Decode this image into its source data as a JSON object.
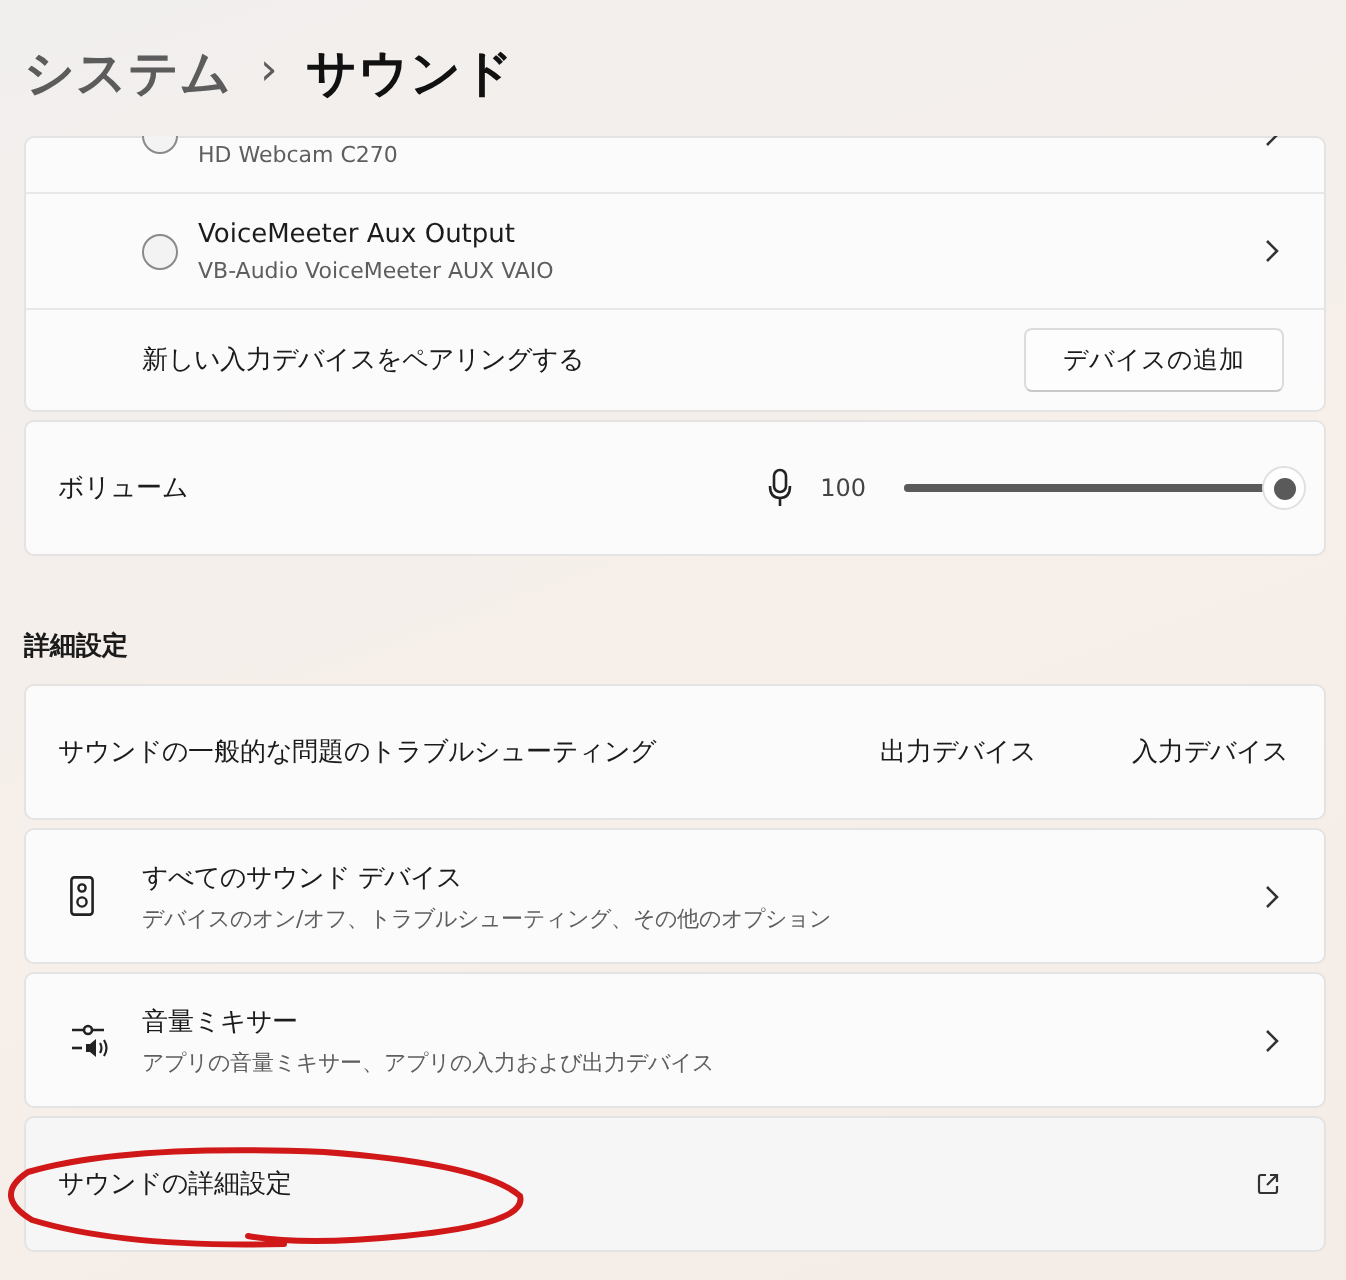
{
  "breadcrumb": {
    "parent": "システム",
    "separator": "›",
    "current": "サウンド"
  },
  "devices": [
    {
      "subtitle": "HD Webcam C270",
      "selected": false
    },
    {
      "name": "VoiceMeeter Aux Output",
      "subtitle": "VB-Audio VoiceMeeter AUX VAIO",
      "selected": false
    }
  ],
  "pair": {
    "label": "新しい入力デバイスをペアリングする",
    "button": "デバイスの追加"
  },
  "volume": {
    "label": "ボリューム",
    "reading": "100",
    "level": 1
  },
  "section_title": "詳細設定",
  "items": [
    {
      "kind": "options",
      "title": "サウンドの一般的な問題のトラブルシューティング",
      "options": [
        "出力デバイス",
        "入力デバイス"
      ]
    },
    {
      "kind": "nav",
      "title": "すべてのサウンド デバイス",
      "subtitle": "デバイスのオン/オフ、トラブルシューティング、その他のオプション"
    },
    {
      "kind": "nav",
      "title": "音量ミキサー",
      "subtitle": "アプリの音量ミキサー、アプリの入力および出力デバイス"
    },
    {
      "kind": "external",
      "title": "サウンドの詳細設定"
    }
  ]
}
